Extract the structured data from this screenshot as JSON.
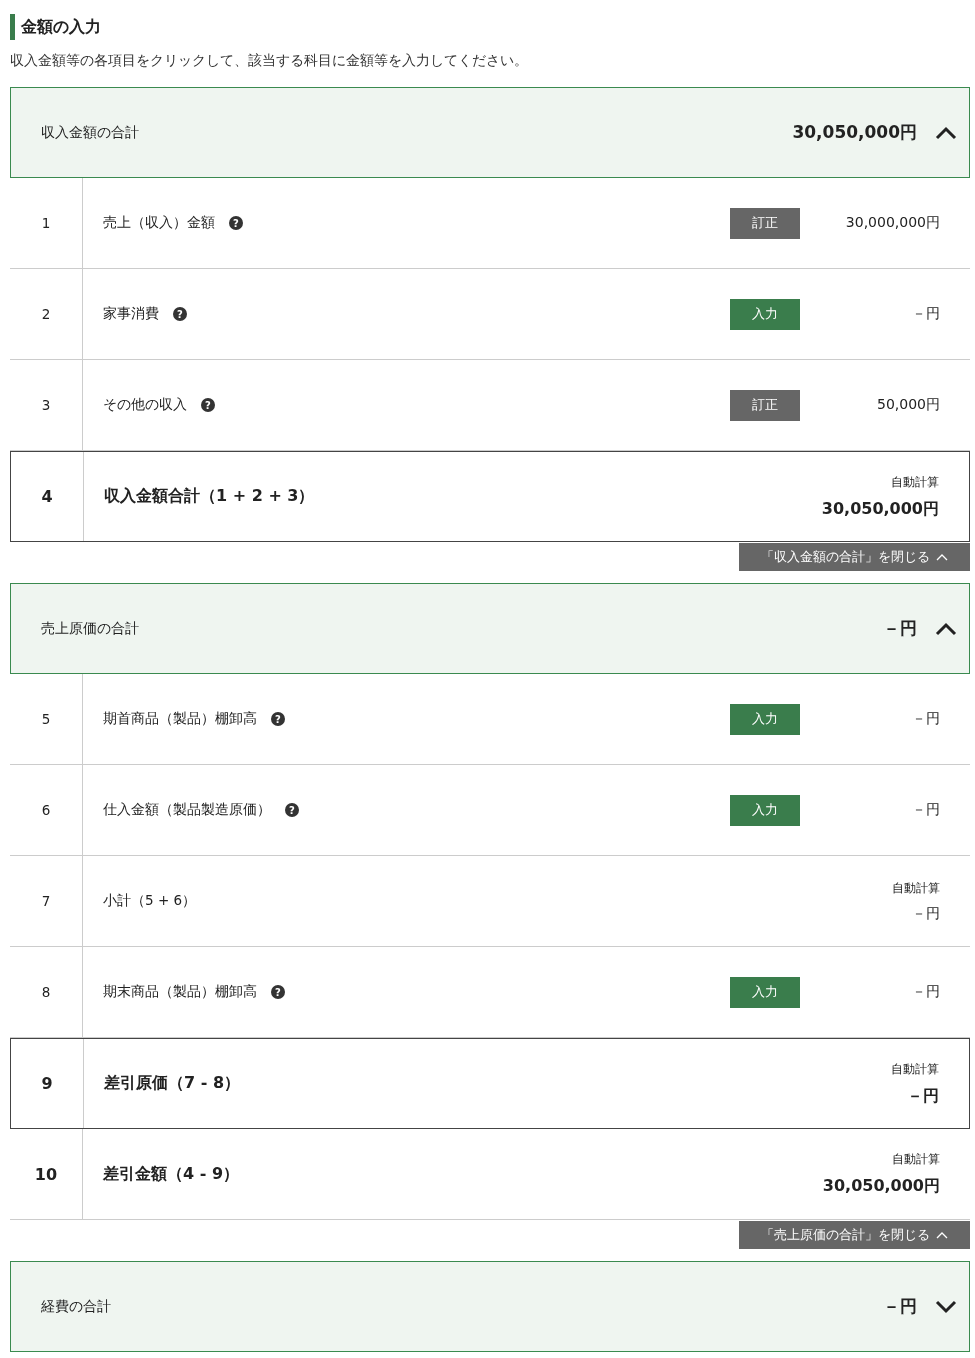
{
  "page": {
    "title": "金額の入力",
    "instruction": "収入金額等の各項目をクリックして、該当する科目に金額等を入力してください。"
  },
  "sections": [
    {
      "title": "収入金額の合計",
      "total": "30,050,000円",
      "expanded": true,
      "close_label": "「収入金額の合計」を閉じる",
      "rows": [
        {
          "kind": "item",
          "number": "1",
          "label": "売上（収入）金額",
          "help": "?",
          "button": {
            "label": "訂正",
            "kind": "edit"
          },
          "amount": "30,000,000円"
        },
        {
          "kind": "item",
          "number": "2",
          "label": "家事消費",
          "help": "?",
          "button": {
            "label": "入力",
            "kind": "input"
          },
          "amount": "－円"
        },
        {
          "kind": "item",
          "number": "3",
          "label": "その他の収入",
          "help": "?",
          "button": {
            "label": "訂正",
            "kind": "edit"
          },
          "amount": "50,000円"
        },
        {
          "kind": "auto",
          "number": "4",
          "label": "収入金額合計（1 + 2 + 3）",
          "bold": true,
          "boxed": true,
          "note": "自動計算",
          "amount": "30,050,000円"
        }
      ]
    },
    {
      "title": "売上原価の合計",
      "total": "－円",
      "expanded": true,
      "close_label": "「売上原価の合計」を閉じる",
      "rows": [
        {
          "kind": "item",
          "number": "5",
          "label": "期首商品（製品）棚卸高",
          "help": "?",
          "button": {
            "label": "入力",
            "kind": "input"
          },
          "amount": "－円"
        },
        {
          "kind": "item",
          "number": "6",
          "label": "仕入金額（製品製造原価）",
          "help": "?",
          "button": {
            "label": "入力",
            "kind": "input"
          },
          "amount": "－円"
        },
        {
          "kind": "auto",
          "number": "7",
          "label": "小計（5 + 6）",
          "bold": false,
          "boxed": false,
          "note": "自動計算",
          "amount": "－円"
        },
        {
          "kind": "item",
          "number": "8",
          "label": "期末商品（製品）棚卸高",
          "help": "?",
          "button": {
            "label": "入力",
            "kind": "input"
          },
          "amount": "－円"
        },
        {
          "kind": "auto",
          "number": "9",
          "label": "差引原価（7 - 8）",
          "bold": true,
          "boxed": true,
          "note": "自動計算",
          "amount": "－円"
        },
        {
          "kind": "auto",
          "number": "10",
          "label": "差引金額（4 - 9）",
          "bold": true,
          "boxed": false,
          "note": "自動計算",
          "amount": "30,050,000円"
        }
      ]
    },
    {
      "title": "経費の合計",
      "total": "－円",
      "expanded": false
    }
  ]
}
